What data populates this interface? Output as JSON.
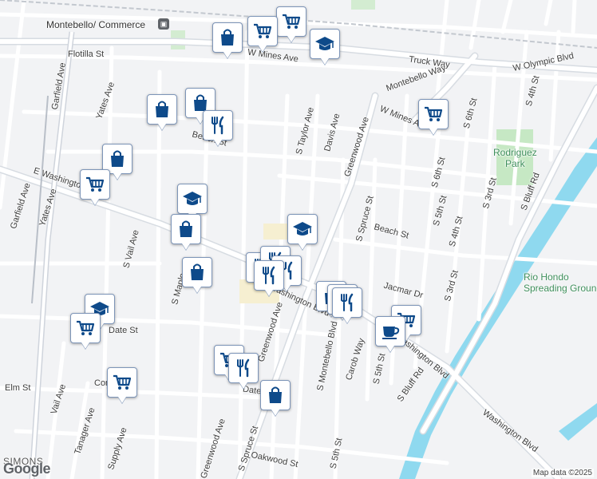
{
  "attribution": "Map data ©2025",
  "logo": "Google",
  "labels": {
    "station": "Montebello/ Commerce",
    "flotilla": "Flotilla St",
    "w_mines_top": "W Mines Ave",
    "truck_way": "Truck Way",
    "w_olympic": "W Olympic Blvd",
    "montebello_way": "Montebello Way",
    "w_mines_mid": "W Mines Ave",
    "garfield_top": "Garfield Ave",
    "yates_top": "Yates Ave",
    "beach_left": "Beach St",
    "taylor": "S Taylor Ave",
    "davis": "Davis Ave",
    "greenwood_top": "Greenwood Ave",
    "rodriguez": "Rodriguez\nPark",
    "s_6th_top": "S 6th St",
    "s_4th_top": "S 4th St",
    "s_bluff_top": "S Bluff Rd",
    "e_washington": "E Washington Blvd",
    "garfield_left": "Garfield Ave",
    "yates_left": "Yates Ave",
    "s_6th_mid": "S 6th St",
    "s_5th_mid": "S 5th St",
    "s_3rd_top": "S 3rd St",
    "s_spruce_top": "S Spruce St",
    "beach_right": "Beach St",
    "s_4th_mid": "S 4th St",
    "s_vail": "S Vail Ave",
    "rio_hondo": "Rio Hondo\nSpreading Grounds",
    "jacmar": "Jacmar Dr",
    "s_3rd_mid": "S 3rd St",
    "s_mo": "S Maple",
    "washington_mid": "Washington Blvd",
    "s_montebello": "S Montebello Blvd",
    "carob": "Carob Way",
    "greenwood_mid": "Greenwood Ave",
    "s_5th_low": "S 5th St",
    "s_bluff_low": "S Bluff Rd",
    "washington_right": "Washington Blvd",
    "washington_low": "Washington Blvd",
    "date_st_left": "Date St",
    "date_st": "Date St",
    "elm": "Elm St",
    "condor": "Condor",
    "vail_low": "Vail Ave",
    "tanager": "Tanager Ave",
    "supply": "Supply Ave",
    "greenwood_low": "Greenwood Ave",
    "s_spruce_low": "S Spruce St",
    "oakwood": "Oakwood St",
    "s_5th_bottom": "S 5th St",
    "simons": "SIMONS"
  },
  "pins": [
    {
      "icon": "grocery",
      "name": "grocery-pin"
    },
    {
      "icon": "grocery",
      "name": "grocery-pin"
    },
    {
      "icon": "shopping",
      "name": "shopping-pin"
    },
    {
      "icon": "school",
      "name": "school-pin"
    },
    {
      "icon": "shopping",
      "name": "shopping-pin"
    },
    {
      "icon": "shopping",
      "name": "shopping-pin"
    },
    {
      "icon": "restaurant",
      "name": "restaurant-pin"
    },
    {
      "icon": "grocery",
      "name": "grocery-pin"
    },
    {
      "icon": "shopping",
      "name": "shopping-pin"
    },
    {
      "icon": "grocery",
      "name": "grocery-pin"
    },
    {
      "icon": "school",
      "name": "school-pin"
    },
    {
      "icon": "shopping",
      "name": "shopping-pin"
    },
    {
      "icon": "school",
      "name": "school-pin"
    },
    {
      "icon": "shopping",
      "name": "shopping-pin"
    },
    {
      "icon": "restaurant",
      "name": "restaurant-pin"
    },
    {
      "icon": "restaurant",
      "name": "restaurant-pin"
    },
    {
      "icon": "restaurant",
      "name": "restaurant-pin"
    },
    {
      "icon": "restaurant",
      "name": "restaurant-pin"
    },
    {
      "icon": "school",
      "name": "school-pin"
    },
    {
      "icon": "grocery",
      "name": "grocery-pin"
    },
    {
      "icon": "shopping",
      "name": "shopping-pin"
    },
    {
      "icon": "restaurant",
      "name": "restaurant-pin"
    },
    {
      "icon": "restaurant",
      "name": "restaurant-pin"
    },
    {
      "icon": "grocery",
      "name": "grocery-pin"
    },
    {
      "icon": "cafe",
      "name": "cafe-pin"
    },
    {
      "icon": "grocery",
      "name": "grocery-pin"
    },
    {
      "icon": "restaurant",
      "name": "restaurant-pin"
    },
    {
      "icon": "shopping",
      "name": "shopping-pin"
    },
    {
      "icon": "grocery",
      "name": "grocery-pin"
    }
  ],
  "colors": {
    "pin_icon": "#0e4a8a",
    "river": "#8fd9ef",
    "park": "#c6e8c4"
  }
}
